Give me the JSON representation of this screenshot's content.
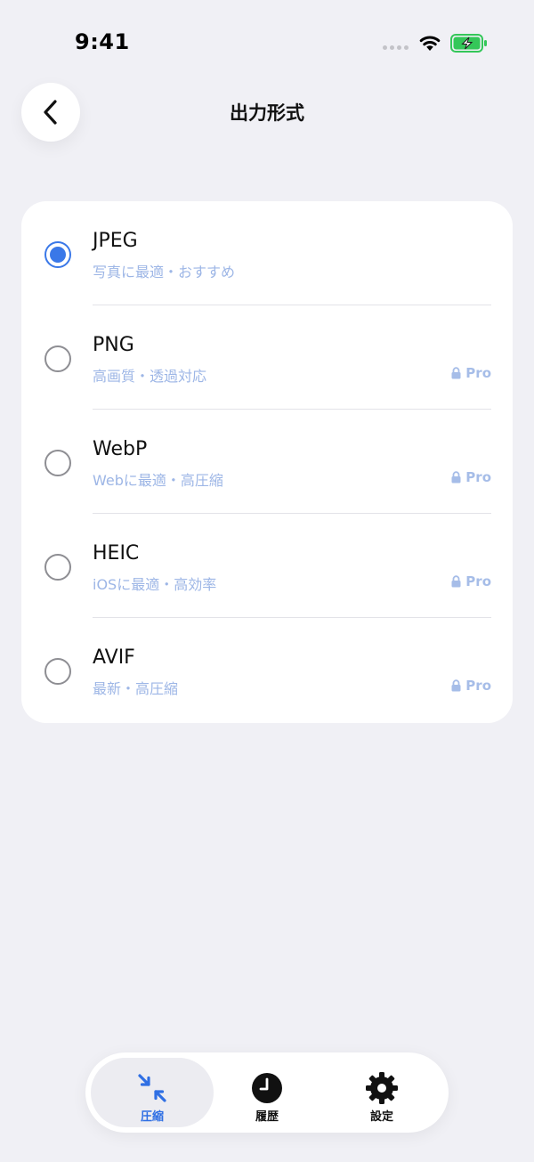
{
  "status_bar": {
    "time": "9:41"
  },
  "header": {
    "title": "出力形式"
  },
  "formats": [
    {
      "name": "JPEG",
      "description": "写真に最適・おすすめ",
      "selected": true,
      "pro": false
    },
    {
      "name": "PNG",
      "description": "高画質・透過対応",
      "selected": false,
      "pro": true,
      "badge": "Pro"
    },
    {
      "name": "WebP",
      "description": "Webに最適・高圧縮",
      "selected": false,
      "pro": true,
      "badge": "Pro"
    },
    {
      "name": "HEIC",
      "description": "iOSに最適・高効率",
      "selected": false,
      "pro": true,
      "badge": "Pro"
    },
    {
      "name": "AVIF",
      "description": "最新・高圧縮",
      "selected": false,
      "pro": true,
      "badge": "Pro"
    }
  ],
  "tab_bar": {
    "tabs": [
      {
        "label": "圧縮",
        "icon": "compress-icon",
        "active": true
      },
      {
        "label": "履歴",
        "icon": "clock-icon",
        "active": false
      },
      {
        "label": "設定",
        "icon": "gear-icon",
        "active": false
      }
    ]
  },
  "colors": {
    "accent": "#3a78e8",
    "background": "#f0f0f5",
    "description_text": "#9db6e6",
    "battery_green": "#34c759"
  }
}
